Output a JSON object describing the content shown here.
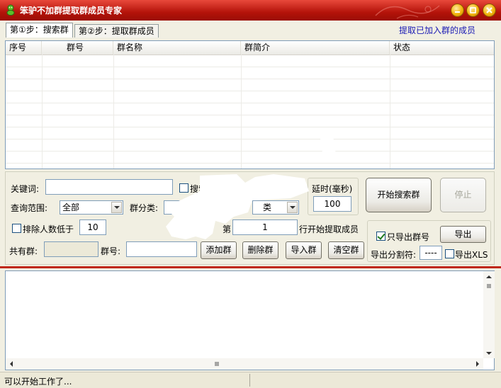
{
  "window": {
    "title": "笨驴不加群提取群成员专家",
    "colors": {
      "titlebar": "#b4130a",
      "accent": "#1a1ab4"
    }
  },
  "tabs": [
    {
      "label": "第①步：搜索群",
      "active": true
    },
    {
      "label": "第②步：提取群成员",
      "active": false
    }
  ],
  "links": {
    "extract_joined": "提取已加入群的成员"
  },
  "grid": {
    "columns": [
      "序号",
      "群号",
      "群名称",
      "群简介",
      "状态"
    ],
    "rows": []
  },
  "search": {
    "keyword_label": "关键词:",
    "keyword_value": "",
    "search_checkbox_label": "搜索",
    "scope_label": "查询范围:",
    "scope_value": "全部",
    "category_label": "群分类:",
    "category_value": "",
    "category_combo_partial": "类",
    "delay_label": "延时(毫秒)",
    "delay_value": "100",
    "start_button": "开始搜索群",
    "stop_button": "停止"
  },
  "filter": {
    "exclude_label": "排除人数低于",
    "exclude_value": "10",
    "from_row_prefix": "第",
    "from_row_value": "1",
    "from_row_suffix": "行开始提取成员"
  },
  "export": {
    "only_group_number_label": "只导出群号",
    "only_group_number_checked": true,
    "export_button": "导出",
    "separator_label": "导出分割符:",
    "separator_value": "----",
    "export_xls_label": "导出XLS",
    "export_xls_checked": false
  },
  "groups": {
    "total_label": "共有群:",
    "total_value": "",
    "group_number_label": "群号:",
    "group_number_value": "",
    "add_button": "添加群",
    "delete_button": "删除群",
    "import_button": "导入群",
    "clear_button": "清空群"
  },
  "log": {
    "text": ""
  },
  "status": {
    "text": "可以开始工作了..."
  }
}
